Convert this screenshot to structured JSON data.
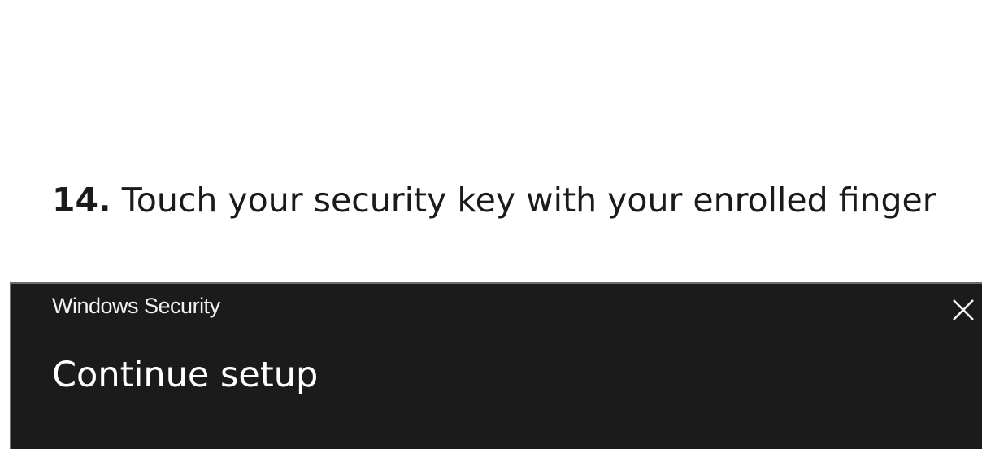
{
  "instruction": {
    "step_number": "14.",
    "text": "Touch your security key with your enrolled finger"
  },
  "dialog": {
    "window_title": "Windows Security",
    "heading": "Continue setup",
    "close_icon": "close-icon"
  }
}
